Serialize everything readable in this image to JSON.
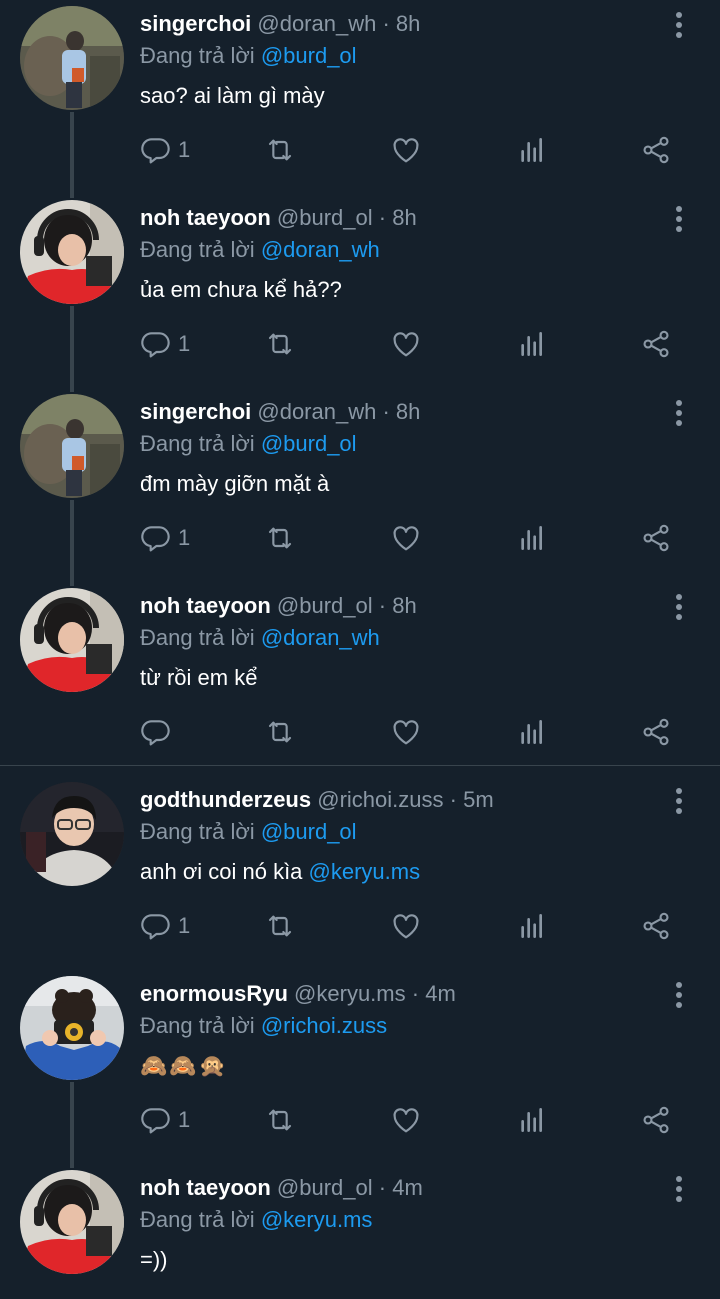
{
  "colors": {
    "background": "#15202b",
    "mention": "#1d9bf0",
    "muted": "#8b98a5",
    "thread_line": "#38444d"
  },
  "tweets": [
    {
      "name": "singerchoi",
      "handle": "@doran_wh",
      "time": "8h",
      "reply_prefix": "Đang trả lời",
      "reply_to": "@burd_ol",
      "text": "sao? ai làm gì mày",
      "text_mention": "",
      "reply_count": "1",
      "avatar": "singerchoi-avatar"
    },
    {
      "name": "noh taeyoon",
      "handle": "@burd_ol",
      "time": "8h",
      "reply_prefix": "Đang trả lời",
      "reply_to": "@doran_wh",
      "text": "ủa em chưa kể hả??",
      "text_mention": "",
      "reply_count": "1",
      "avatar": "noh-taeyoon-avatar"
    },
    {
      "name": "singerchoi",
      "handle": "@doran_wh",
      "time": "8h",
      "reply_prefix": "Đang trả lời",
      "reply_to": "@burd_ol",
      "text": "đm mày giỡn mặt à",
      "text_mention": "",
      "reply_count": "1",
      "avatar": "singerchoi-avatar"
    },
    {
      "name": "noh taeyoon",
      "handle": "@burd_ol",
      "time": "8h",
      "reply_prefix": "Đang trả lời",
      "reply_to": "@doran_wh",
      "text": "từ rồi em kể",
      "text_mention": "",
      "reply_count": "",
      "avatar": "noh-taeyoon-avatar"
    },
    {
      "name": "godthunderzeus",
      "handle": "@richoi.zuss",
      "time": "5m",
      "reply_prefix": "Đang trả lời",
      "reply_to": "@burd_ol",
      "text": "anh ơi coi nó kìa ",
      "text_mention": "@keryu.ms",
      "reply_count": "1",
      "avatar": "godthunderzeus-avatar"
    },
    {
      "name": "enormousRyu",
      "handle": "@keryu.ms",
      "time": "4m",
      "reply_prefix": "Đang trả lời",
      "reply_to": "@richoi.zuss",
      "text": "🙈🙈🙊",
      "text_mention": "",
      "reply_count": "1",
      "avatar": "enormousryu-avatar"
    },
    {
      "name": "noh taeyoon",
      "handle": "@burd_ol",
      "time": "4m",
      "reply_prefix": "Đang trả lời",
      "reply_to": "@keryu.ms",
      "text": "=))",
      "text_mention": "",
      "reply_count": "",
      "avatar": "noh-taeyoon-avatar"
    }
  ]
}
